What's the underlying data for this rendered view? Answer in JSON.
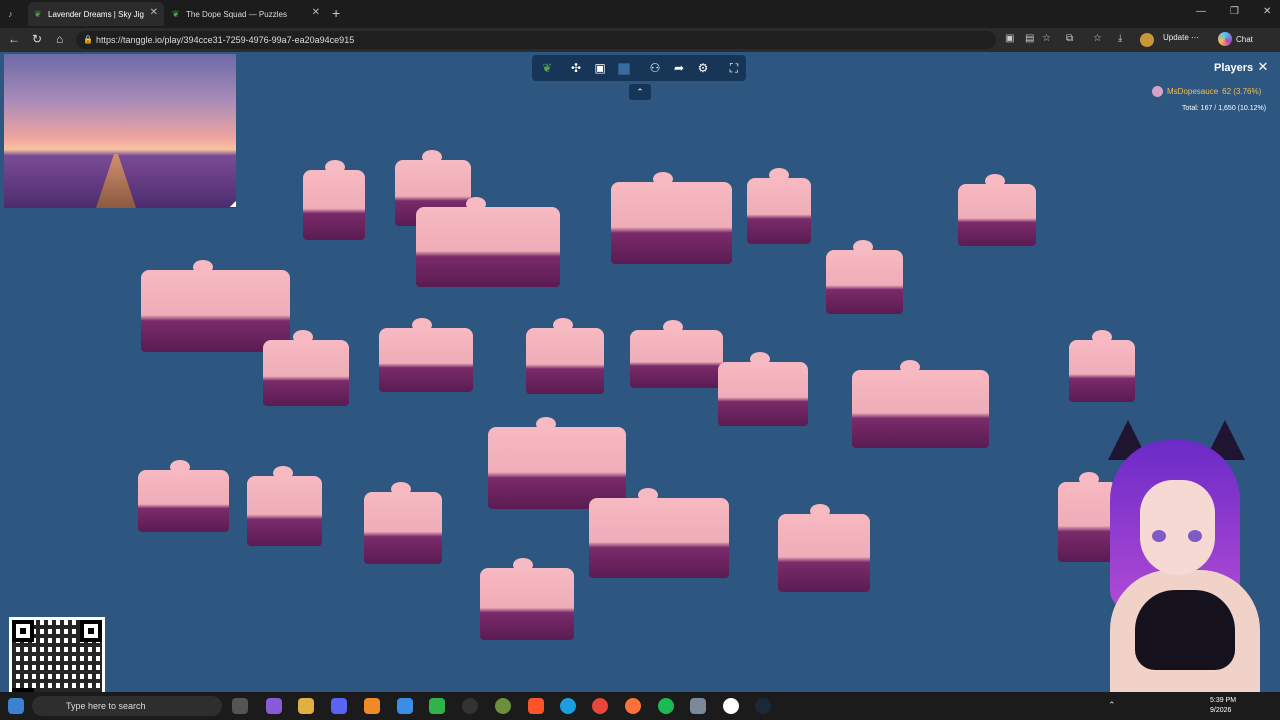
{
  "tabs": [
    {
      "title": "Lavender Dreams | Sky Jig",
      "active": true,
      "icon": "leaf-icon"
    },
    {
      "title": "The Dope Squad — Puzzles",
      "active": false,
      "icon": "leaf-icon"
    }
  ],
  "address": {
    "url": "https://tanggle.io/play/394cce31-7259-4976-99a7-ea20a94ce915",
    "update_label": "Update ⋯",
    "chat_label": "Chat"
  },
  "game": {
    "toolbar_icons": [
      "leaf-icon",
      "puzzle-icon",
      "image-icon",
      "background-icon",
      "players-icon",
      "share-icon",
      "settings-icon",
      "fullscreen-icon"
    ],
    "collapse_icon": "chevron-up-icon",
    "players_title": "Players",
    "player": {
      "name": "MsDopesauce",
      "score": "62 (3.76%)"
    },
    "total": "Total: 167 / 1,650 (10.12%)"
  },
  "taskbar": {
    "search_placeholder": "Type here to search",
    "clock_time": "5:39 PM",
    "clock_date": "9/2026"
  },
  "colors": {
    "board": "#2d5680",
    "toolbar": "#173556",
    "player_name": "#f3c04b"
  }
}
